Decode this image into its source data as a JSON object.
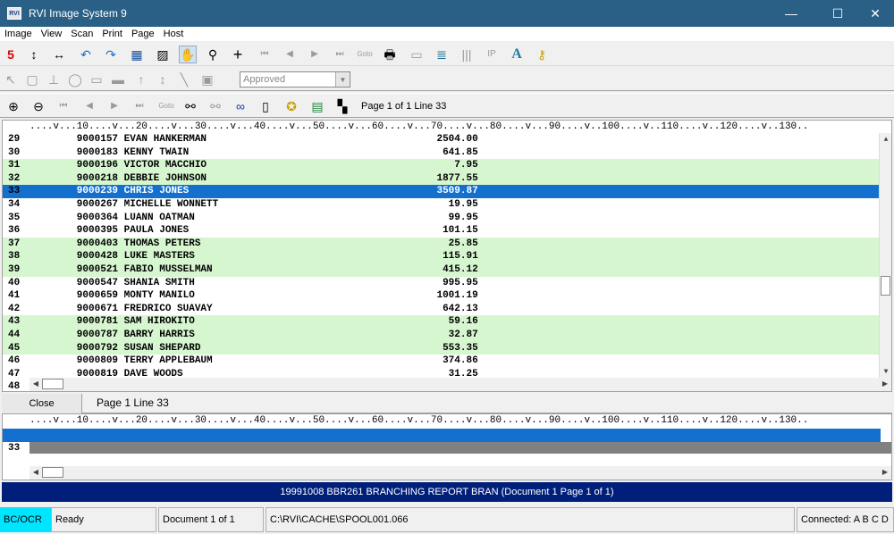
{
  "window": {
    "title": "RVI Image System 9",
    "app_icon": "RVI",
    "minimize": "—",
    "maximize": "☐",
    "close": "✕"
  },
  "menu": [
    "Image",
    "View",
    "Scan",
    "Print",
    "Page",
    "Host"
  ],
  "toolbar2": {
    "status_select": "Approved"
  },
  "toolbar3": {
    "page_info": "Page 1 of 1 Line 33"
  },
  "ruler": "....v...10....v...20....v...30....v...40....v...50....v...60....v...70....v...80....v...90....v..100....v..110....v..120....v..130..",
  "report_rows": [
    {
      "line": "29",
      "text": "        9000157 EVAN HANKERMAN                                       2504.00",
      "style": "w"
    },
    {
      "line": "30",
      "text": "        9000183 KENNY TWAIN                                           641.85",
      "style": "w"
    },
    {
      "line": "31",
      "text": "        9000196 VICTOR MACCHIO                                          7.95",
      "style": "g"
    },
    {
      "line": "32",
      "text": "        9000218 DEBBIE JOHNSON                                       1877.55",
      "style": "g"
    },
    {
      "line": "33",
      "text": "        9000239 CHRIS JONES                                          3509.87",
      "style": "s"
    },
    {
      "line": "34",
      "text": "        9000267 MICHELLE WONNETT                                       19.95",
      "style": "w"
    },
    {
      "line": "35",
      "text": "        9000364 LUANN OATMAN                                           99.95",
      "style": "w"
    },
    {
      "line": "36",
      "text": "        9000395 PAULA JONES                                           101.15",
      "style": "w"
    },
    {
      "line": "37",
      "text": "        9000403 THOMAS PETERS                                          25.85",
      "style": "g"
    },
    {
      "line": "38",
      "text": "        9000428 LUKE MASTERS                                          115.91",
      "style": "g"
    },
    {
      "line": "39",
      "text": "        9000521 FABIO MUSSELMAN                                       415.12",
      "style": "g"
    },
    {
      "line": "40",
      "text": "        9000547 SHANIA SMITH                                          995.95",
      "style": "w"
    },
    {
      "line": "41",
      "text": "        9000659 MONTY MANILO                                         1001.19",
      "style": "w"
    },
    {
      "line": "42",
      "text": "        9000671 FREDRICO SUAVAY                                       642.13",
      "style": "w"
    },
    {
      "line": "43",
      "text": "        9000781 SAM HIROKITO                                           59.16",
      "style": "g"
    },
    {
      "line": "44",
      "text": "        9000787 BARRY HARRIS                                           32.87",
      "style": "g"
    },
    {
      "line": "45",
      "text": "        9000792 SUSAN SHEPARD                                         553.35",
      "style": "g"
    },
    {
      "line": "46",
      "text": "        9000809 TERRY APPLEBAUM                                       374.86",
      "style": "w"
    },
    {
      "line": "47",
      "text": "        9000819 DAVE WOODS                                             31.25",
      "style": "w"
    },
    {
      "line": "48",
      "text": "",
      "style": "w"
    }
  ],
  "close_bar": {
    "button": "Close",
    "label": "Page 1 Line 33"
  },
  "detail_row": {
    "line": "33",
    "text": "        9000239 CHRIS JONES                                          3509.87"
  },
  "doc_bar": "19991008 BBR261 BRANCHING REPORT BRAN (Document 1 Page 1 of 1)",
  "status": {
    "mode": "BC/OCR",
    "state": "Ready",
    "document": "Document 1 of 1",
    "path": "C:\\RVI\\CACHE\\SPOOL001.066",
    "connection": "Connected: A B C D"
  },
  "colors": {
    "title_bar": "#2a5f86",
    "selected_row": "#1470cf",
    "green_row": "#d6f6cf",
    "doc_bar": "#001f7a",
    "mode_badge": "#00e5ff"
  }
}
